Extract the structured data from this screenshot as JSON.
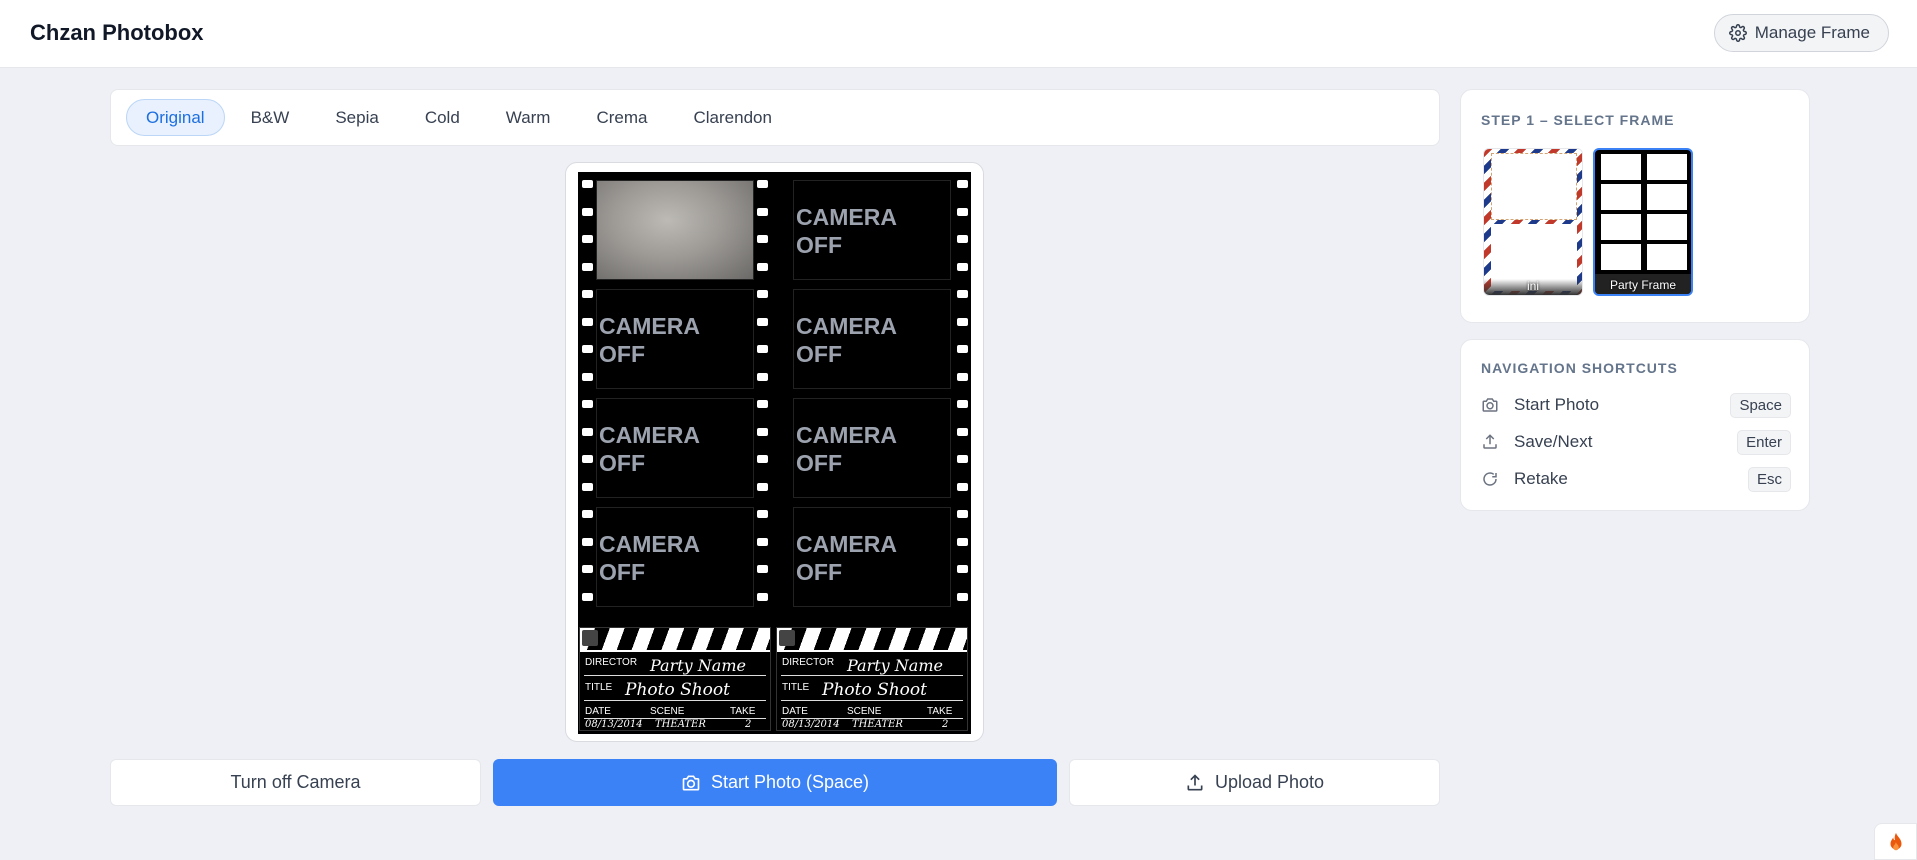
{
  "app": {
    "title": "Chzan Photobox"
  },
  "header": {
    "manage_frame_label": "Manage Frame"
  },
  "filters": [
    {
      "label": "Original",
      "active": true
    },
    {
      "label": "B&W",
      "active": false
    },
    {
      "label": "Sepia",
      "active": false
    },
    {
      "label": "Cold",
      "active": false
    },
    {
      "label": "Warm",
      "active": false
    },
    {
      "label": "Crema",
      "active": false
    },
    {
      "label": "Clarendon",
      "active": false
    }
  ],
  "preview": {
    "camera_off_text": "CAMERA\nOFF",
    "clapper": {
      "director_label": "DIRECTOR",
      "director_value": "Party Name",
      "title_label": "TITLE",
      "title_value": "Photo Shoot",
      "date_label": "DATE",
      "scene_label": "SCENE",
      "take_label": "TAKE",
      "date_value": "08/13/2014",
      "scene_value": "THEATER",
      "take_value": "2"
    }
  },
  "actions": {
    "turn_off_camera": "Turn off Camera",
    "start_photo": "Start Photo (Space)",
    "upload_photo": "Upload Photo"
  },
  "frame_panel": {
    "title": "STEP 1 – SELECT FRAME",
    "frames": [
      {
        "label": "ini",
        "selected": false
      },
      {
        "label": "Party Frame",
        "selected": true
      }
    ]
  },
  "shortcuts": {
    "title": "NAVIGATION SHORTCUTS",
    "items": [
      {
        "icon": "camera-icon",
        "label": "Start Photo",
        "key": "Space"
      },
      {
        "icon": "upload-icon",
        "label": "Save/Next",
        "key": "Enter"
      },
      {
        "icon": "refresh-icon",
        "label": "Retake",
        "key": "Esc"
      }
    ]
  },
  "colors": {
    "primary": "#3b82f6",
    "active_filter": "#1d6fe0",
    "background": "#eef0f5"
  }
}
